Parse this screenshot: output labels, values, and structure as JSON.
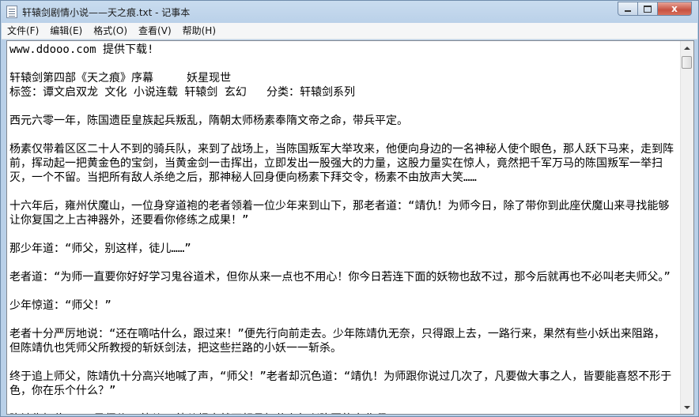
{
  "window": {
    "title": "轩辕剑剧情小说——天之痕.txt - 记事本",
    "close_glyph": "x"
  },
  "menu": [
    {
      "label": "文件(F)"
    },
    {
      "label": "编辑(E)"
    },
    {
      "label": "格式(O)"
    },
    {
      "label": "查看(V)"
    },
    {
      "label": "帮助(H)"
    }
  ],
  "document": {
    "lines": [
      {
        "text": "www.ddooo.com 提供下载!",
        "gap": false
      },
      {
        "text": "轩辕剑第四部《天之痕》序幕     妖星现世",
        "gap": true
      },
      {
        "text": "标签：谭文启双龙 文化 小说连载 轩辕剑 玄幻   分类：轩辕剑系列",
        "gap": false
      },
      {
        "text": "西元六零一年，陈国遗臣皇族起兵叛乱，隋朝太师杨素奉隋文帝之命，带兵平定。",
        "gap": true
      },
      {
        "text": "杨素仅带着区区二十人不到的骑兵队，来到了战场上，当陈国叛军大举攻来，他便向身边的一名神秘人使个眼色，那人跃下马来，走到阵前，挥动起一把黄金色的宝剑，当黄金剑一击挥出，立即发出一股强大的力量，这股力量实在惊人，竟然把千军万马的陈国叛军一举扫灭，一个不留。当把所有敌人杀绝之后，那神秘人回身便向杨素下拜交令，杨素不由放声大笑……",
        "gap": true
      },
      {
        "text": "十六年后，雍州伏魔山，一位身穿道袍的老者领着一位少年来到山下，那老者道：“靖仇！为师今日，除了带你到此座伏魔山来寻找能够让你复国之上古神器外，还要看你修练之成果！”",
        "gap": true
      },
      {
        "text": "那少年道：“师父，别这样，徒儿……”",
        "gap": true
      },
      {
        "text": "老者道：“为师一直要你好好学习鬼谷道术，但你从来一点也不用心！你今日若连下面的妖物也敌不过，那今后就再也不必叫老夫师父。”",
        "gap": true
      },
      {
        "text": "少年惊道：“师父！”",
        "gap": true
      },
      {
        "text": "老者十分严厉地说：“还在嘀咕什么，跟过来！”便先行向前走去。少年陈靖仇无奈，只得跟上去，一路行来，果然有些小妖出来阻路，但陈靖仇也凭师父所教授的斩妖剑法，把这些拦路的小妖一一斩杀。",
        "gap": true
      },
      {
        "text": "终于追上师父，陈靖仇十分高兴地喊了声，“师父！”老者却沉色道：“靖仇！为师跟你说过几次了，凡要做大事之人，皆要能喜怒不形于色，你在乐个什么？”",
        "gap": true
      },
      {
        "text": "陈靖仇怔住：“可是师父……徒儿……徒儿根本就不想承担什么复兴陈国的大业啊！”",
        "gap": true
      }
    ]
  }
}
